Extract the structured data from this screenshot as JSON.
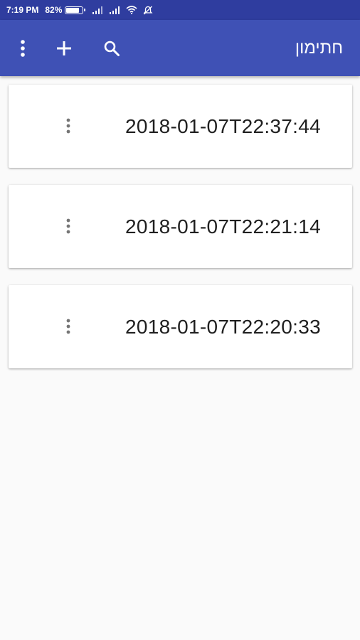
{
  "status_bar": {
    "time": "7:19 PM",
    "battery_percent": "82%",
    "battery_level": 0.82
  },
  "app_bar": {
    "title": "חתימון",
    "menu_icon": "more-vert-icon",
    "add_icon": "plus-icon",
    "search_icon": "search-icon"
  },
  "items": [
    {
      "label": "2018-01-07T22:37:44"
    },
    {
      "label": "2018-01-07T22:21:14"
    },
    {
      "label": "2018-01-07T22:20:33"
    }
  ],
  "colors": {
    "primary": "#3f51b5",
    "primary_dark": "#2f3d9f",
    "background": "#fafafa"
  }
}
